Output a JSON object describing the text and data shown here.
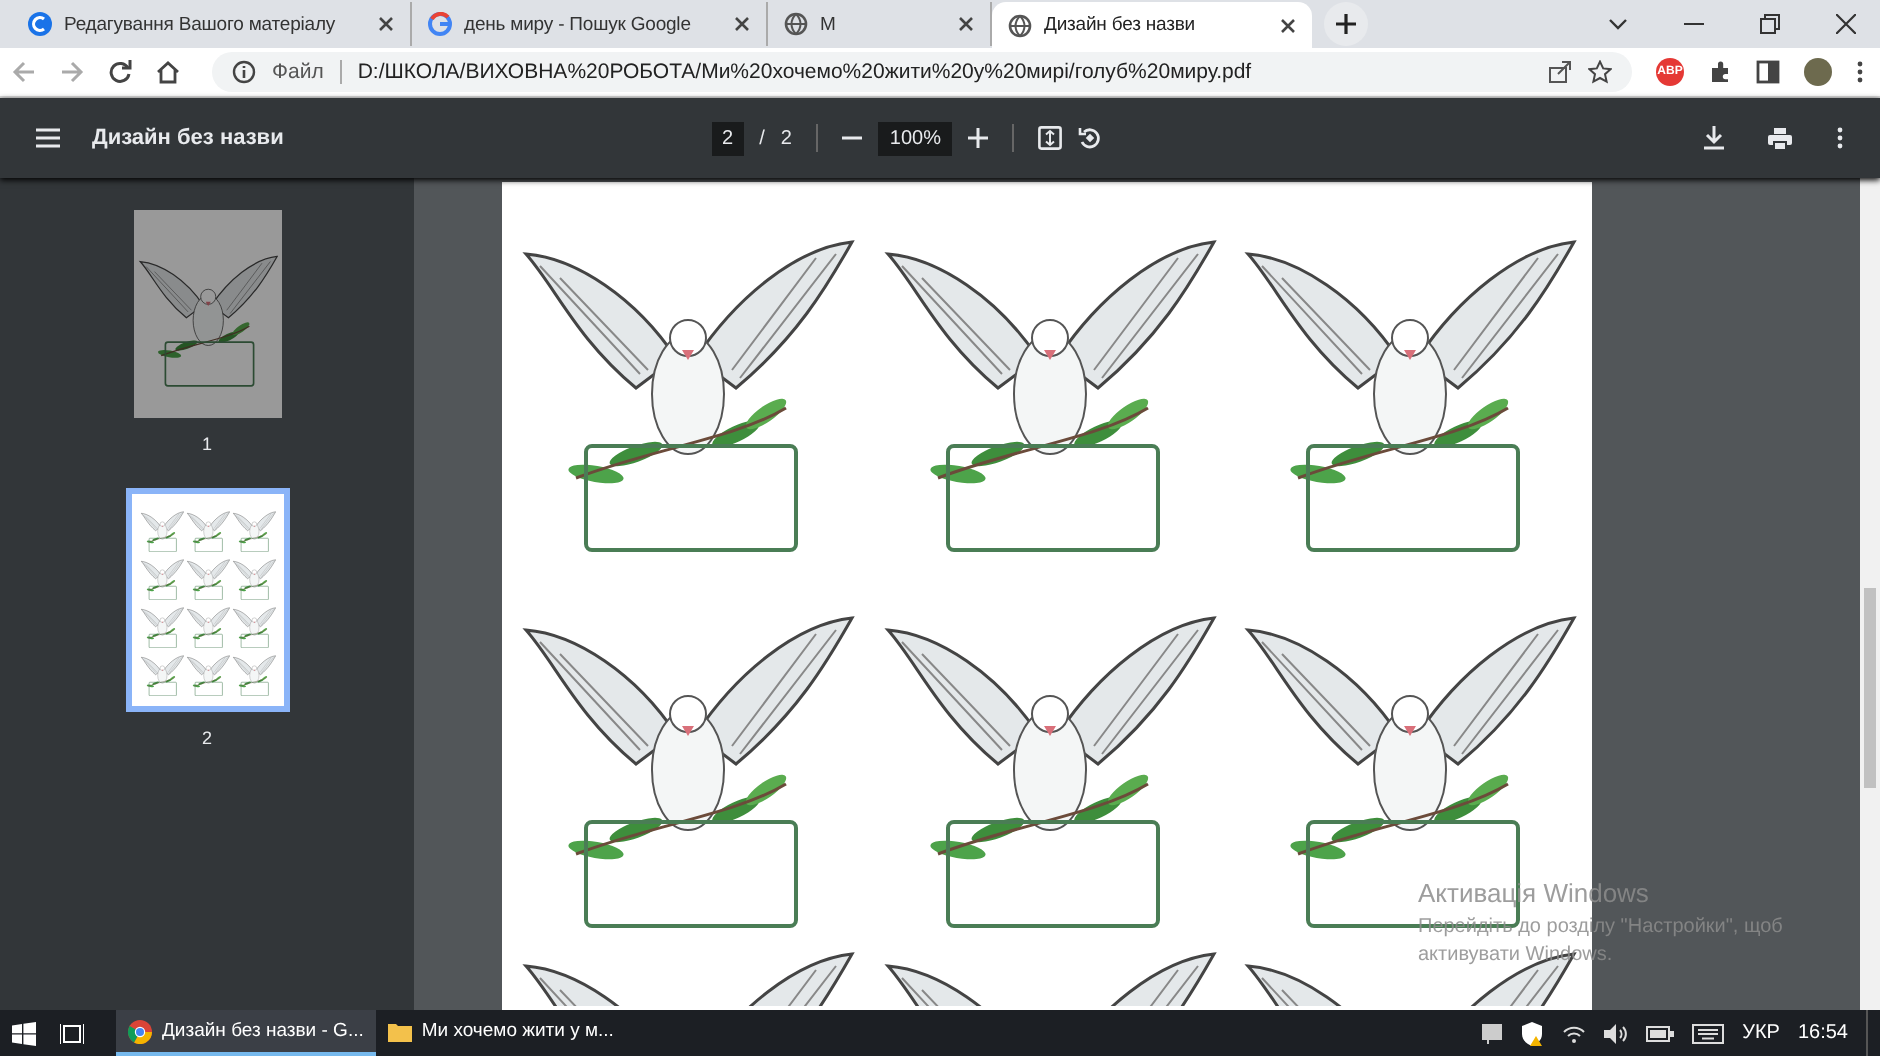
{
  "tabs": [
    {
      "title": "Редагування Вашого матеріалу",
      "kind": "edit",
      "selected": false
    },
    {
      "title": "день миру - Пошук Google",
      "kind": "google",
      "selected": false
    },
    {
      "title": "М",
      "kind": "globe",
      "selected": false
    },
    {
      "title": "Дизайн без назви",
      "kind": "globe",
      "selected": true
    }
  ],
  "address_bar": {
    "scheme_label": "Файл",
    "url": "D:/ШКОЛА/ВИХОВНА%20РОБОТА/Ми%20хочемо%20жити%20у%20мирі/голуб%20миру.pdf",
    "extension_badge": "ABP"
  },
  "pdf_toolbar": {
    "title": "Дизайн без назви",
    "page": "2",
    "separator": "/",
    "total": "2",
    "zoom": "100%"
  },
  "thumbnails": [
    {
      "label": "1",
      "selected": false
    },
    {
      "label": "2",
      "selected": true
    }
  ],
  "activation_notice": {
    "title": "Активація Windows",
    "message": "Перейдіть до розділу \"Настройки\", щоб активувати Windows."
  },
  "taskbar": {
    "items": [
      {
        "label": "Дизайн без назви - G...",
        "kind": "chrome",
        "selected": true
      },
      {
        "label": "Ми хочемо жити у м...",
        "kind": "folder",
        "selected": false
      }
    ],
    "language": "УКР",
    "time": "16:54"
  }
}
